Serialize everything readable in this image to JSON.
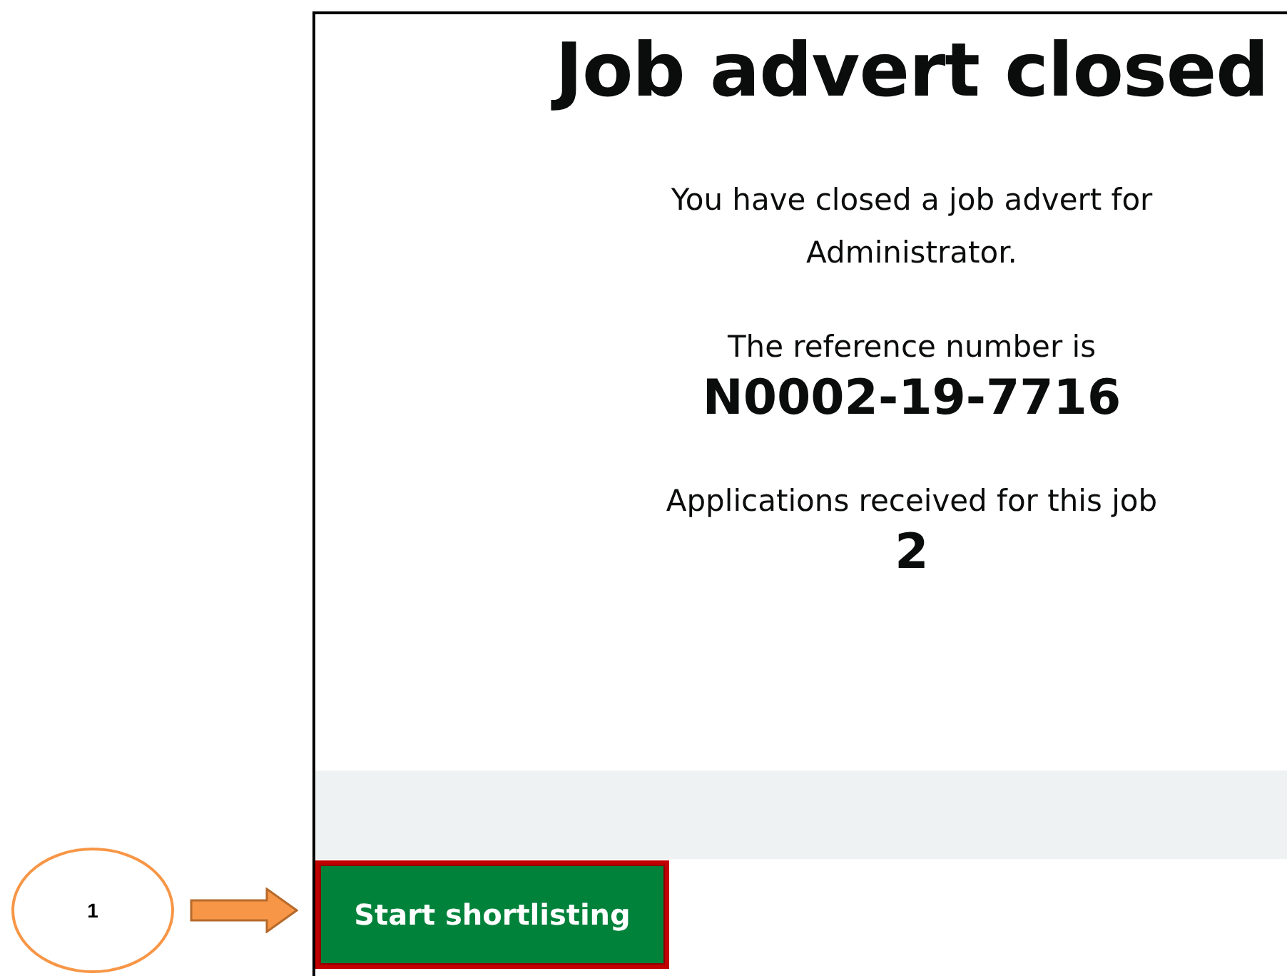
{
  "panel": {
    "title": "Job advert closed",
    "message": "You have closed a job advert for Administrator.",
    "reference_label": "The reference number is",
    "reference_number": "N0002-19-7716",
    "applications_label": "Applications received for this job",
    "applications_count": "2"
  },
  "button": {
    "label": "Start shortlisting",
    "highlighted": true
  },
  "callout": {
    "number": "1"
  }
}
